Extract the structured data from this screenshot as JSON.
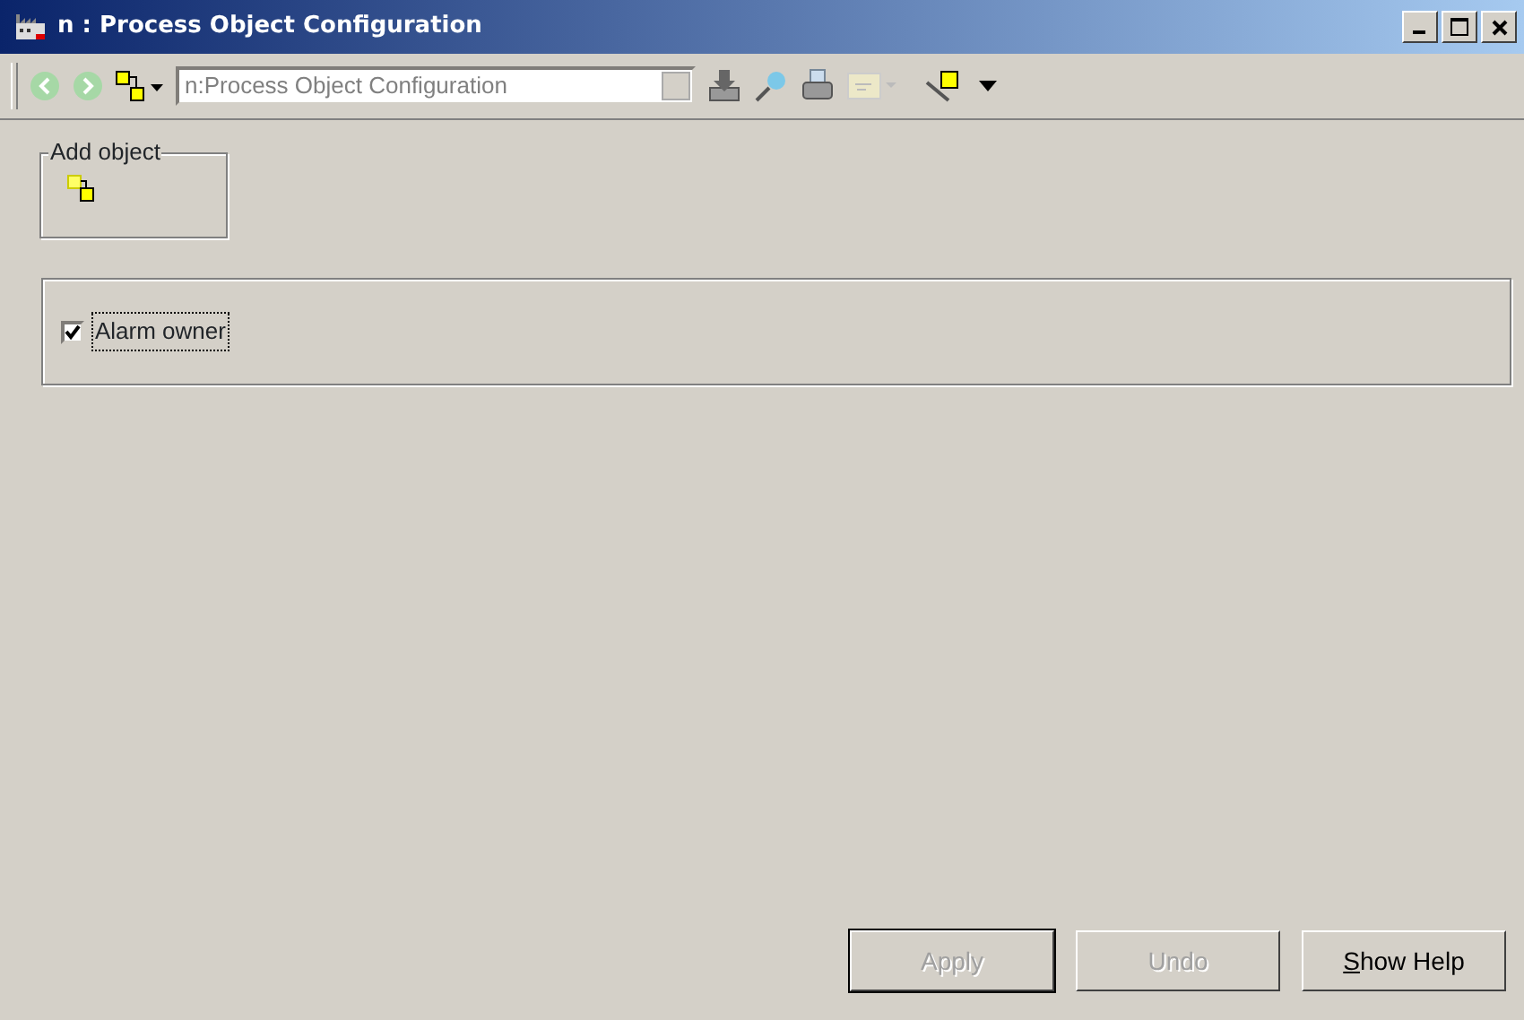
{
  "window": {
    "title": "n : Process Object Configuration"
  },
  "toolbar": {
    "address": {
      "value": "n:Process Object Configuration",
      "disabled": true
    },
    "back_disabled": true,
    "forward_disabled": true
  },
  "add_object": {
    "label": "Add object"
  },
  "options": [
    {
      "label": "Alarm owner",
      "checked": true
    }
  ],
  "buttons": [
    {
      "label": "Apply",
      "disabled": true,
      "default": true
    },
    {
      "label": "Undo",
      "disabled": true,
      "default": false
    },
    {
      "label": "Show Help",
      "disabled": false,
      "default": false
    }
  ]
}
